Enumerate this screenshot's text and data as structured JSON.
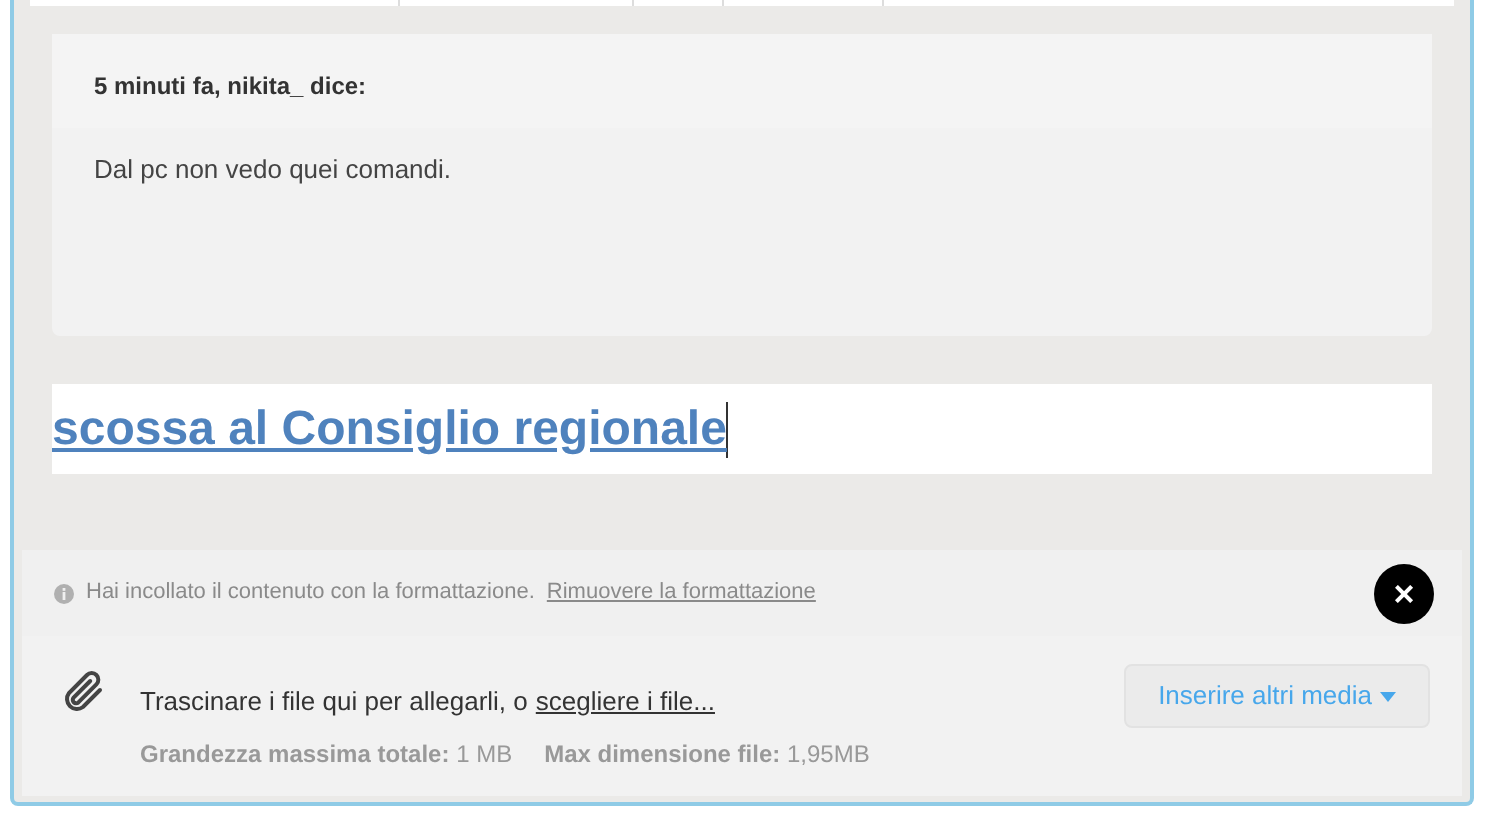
{
  "quote": {
    "attribution": "5 minuti fa, nikita_ dice:",
    "text": "Dal pc non vedo quei comandi."
  },
  "editor": {
    "text": "scossa al Consiglio regionale"
  },
  "notice": {
    "text": "Hai incollato il contenuto con la formattazione.",
    "link": "Rimuovere la formattazione",
    "close": "×"
  },
  "attachments": {
    "text": "Trascinare i file qui per allegarli, o",
    "link": "scegliere i file...",
    "limits": [
      {
        "label": "Grandezza massima totale:",
        "value": "1 MB"
      },
      {
        "label": "Max dimensione file:",
        "value": "1,95MB"
      }
    ],
    "button": "Inserire altri media"
  }
}
